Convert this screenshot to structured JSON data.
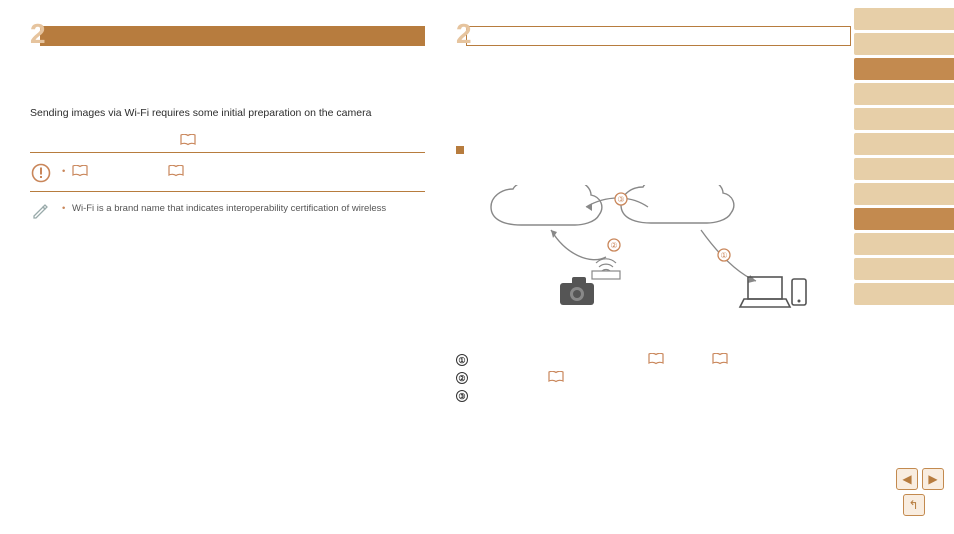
{
  "left": {
    "big_number": "2",
    "section_title": "",
    "intro": "Sending images via Wi-Fi requires some initial preparation on the camera",
    "subhead_book_ref": "",
    "warning_items": {
      "line1": "",
      "ref_a": "",
      "ref_b": ""
    },
    "note_item": "Wi-Fi is a brand name that indicates interoperability certification of wireless"
  },
  "right": {
    "big_number": "2",
    "section_title": "",
    "sub_marker": "",
    "num_list": {
      "n1": "①",
      "n2": "②",
      "n3": "③",
      "ref1": "",
      "ref1b": "",
      "ref2": ""
    }
  },
  "diagram": {
    "badge1": "①",
    "badge2": "②",
    "badge3": "③"
  },
  "nav": {
    "prev_glyph": "◀",
    "next_glyph": "▶",
    "return_glyph": "↰"
  }
}
